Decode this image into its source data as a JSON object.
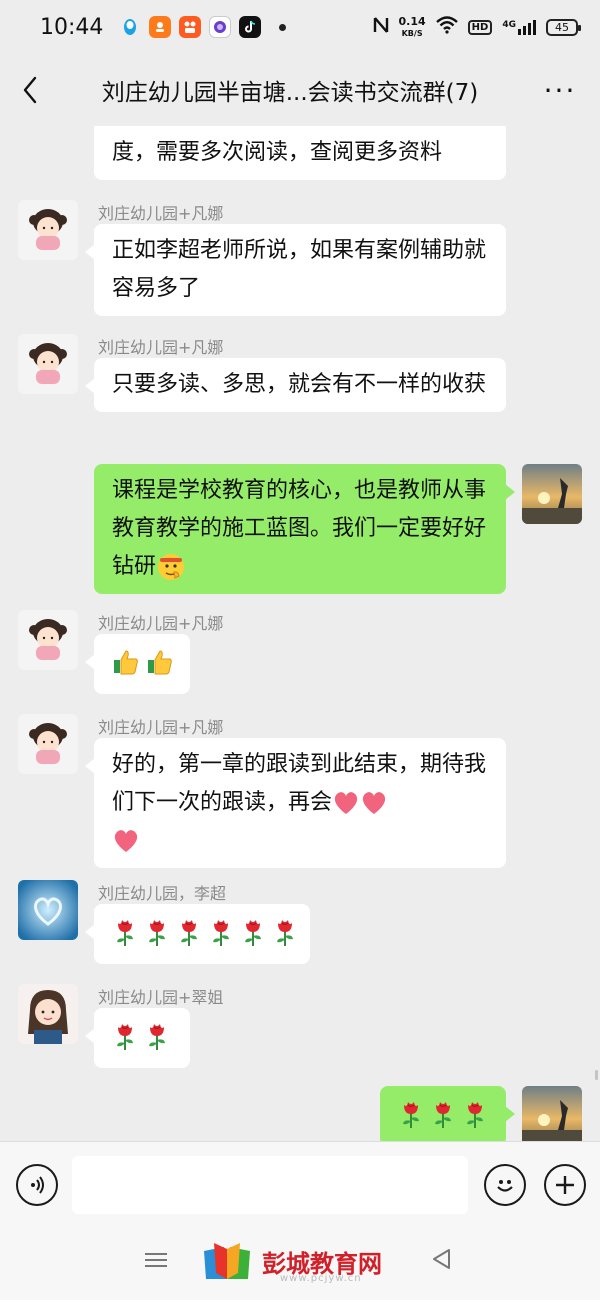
{
  "status_bar": {
    "time": "10:44",
    "net_speed_value": "0.14",
    "net_speed_unit": "KB/S",
    "hd": "HD",
    "signal": "4G",
    "battery": "45",
    "app_icons": [
      "qq-icon",
      "taobao-icon",
      "kuaishou-icon",
      "purple-app-icon",
      "tiktok-icon"
    ]
  },
  "header": {
    "title": "刘庄幼儿园半亩塘...会读书交流群(7)",
    "back_icon": "chevron-left-icon",
    "more_label": "···"
  },
  "messages": [
    {
      "id": "m0",
      "side": "left",
      "partial": true,
      "text": "度，需要多次阅读，查阅更多资料"
    },
    {
      "id": "m1",
      "side": "left",
      "sender": "刘庄幼儿园+凡娜",
      "text": "正如李超老师所说，如果有案例辅助就容易多了"
    },
    {
      "id": "m2",
      "side": "left",
      "sender": "刘庄幼儿园+凡娜",
      "text": "只要多读、多思，就会有不一样的收获"
    },
    {
      "id": "m3",
      "side": "right",
      "text": "课程是学校教育的核心，也是教师从事教育教学的施工蓝图。我们一定要好好钻研",
      "emoji": "thinking-face-emoji"
    },
    {
      "id": "m4",
      "side": "left",
      "sender": "刘庄幼儿园+凡娜",
      "emojis": [
        "thumbs-up-emoji",
        "thumbs-up-emoji"
      ]
    },
    {
      "id": "m5",
      "side": "left",
      "sender": "刘庄幼儿园+凡娜",
      "text": "好的，第一章的跟读到此结束，期待我们下一次的跟读，再会",
      "emojis": [
        "heart-emoji",
        "heart-emoji",
        "heart-emoji"
      ]
    },
    {
      "id": "m6",
      "side": "left",
      "sender": "刘庄幼儿园，李超",
      "emojis": [
        "rose-emoji",
        "rose-emoji",
        "rose-emoji",
        "rose-emoji",
        "rose-emoji",
        "rose-emoji"
      ]
    },
    {
      "id": "m7",
      "side": "left",
      "sender": "刘庄幼儿园+翠姐",
      "emojis": [
        "rose-emoji",
        "rose-emoji"
      ]
    },
    {
      "id": "m8",
      "side": "right",
      "emojis": [
        "rose-emoji",
        "rose-emoji",
        "rose-emoji"
      ]
    }
  ],
  "input_bar": {
    "placeholder": "",
    "voice_icon": "voice-icon",
    "emoji_icon": "smiley-icon",
    "plus_icon": "plus-icon"
  },
  "nav_bar": {
    "watermark_text": "彭城教育网",
    "watermark_url": "www.pcjyw.cn"
  },
  "colors": {
    "background": "#ededed",
    "bubble_self": "#95ec69",
    "bubble_other": "#ffffff",
    "sender_name": "#8a8a8a",
    "watermark": "#d0202a"
  }
}
